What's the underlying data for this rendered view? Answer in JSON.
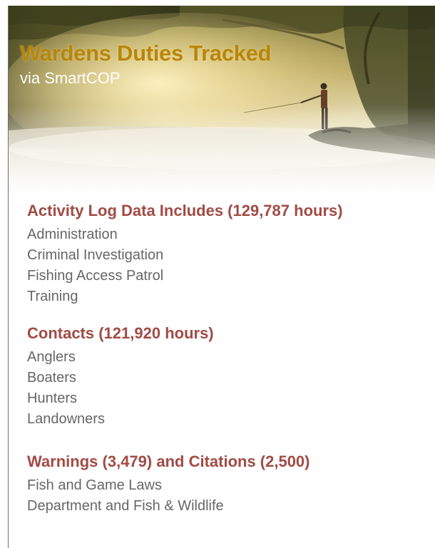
{
  "header": {
    "title": "Wardens Duties Tracked",
    "subtitle": "via SmartCOP"
  },
  "sections": [
    {
      "heading": "Activity Log Data Includes (129,787 hours)",
      "items": [
        "Administration",
        "Criminal Investigation",
        "Fishing Access Patrol",
        "Training"
      ]
    },
    {
      "heading": "Contacts (121,920 hours)",
      "items": [
        "Anglers",
        "Boaters",
        "Hunters",
        "Landowners"
      ]
    },
    {
      "heading": "Warnings (3,479) and Citations (2,500)",
      "items": [
        "Fish and Game Laws",
        "Department and Fish & Wildlife"
      ]
    }
  ],
  "colors": {
    "title": "#b8860b",
    "heading": "#a14b45",
    "item": "#666666"
  }
}
